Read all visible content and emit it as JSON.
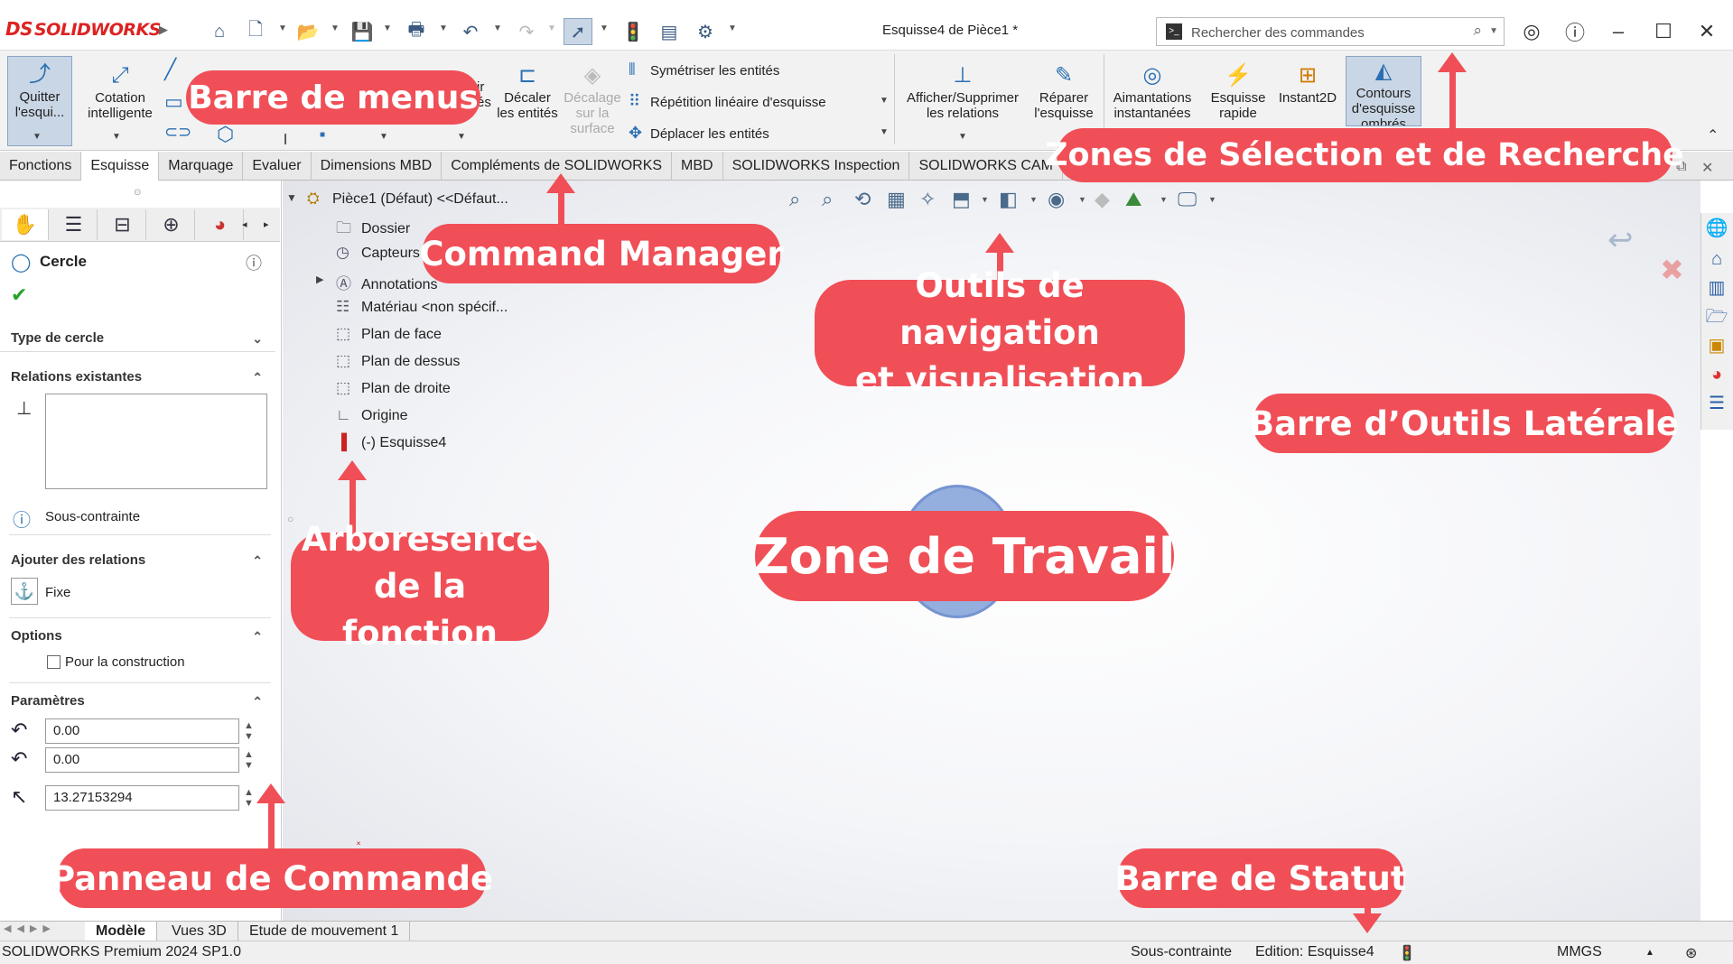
{
  "app": {
    "logo_text": "SOLIDWORKS",
    "logo_mark": "DS",
    "document_title": "Esquisse4 de Pièce1 *"
  },
  "search": {
    "placeholder": "Rechercher des commandes"
  },
  "ribbon": {
    "quit_sketch": "Quitter l'esqui...",
    "smart_dimension": "Cotation intelligente",
    "offset_entities_partial": "ir\nés",
    "offset_entities": "Décaler les entités",
    "offset_on_surface": "Décalage sur la surface",
    "mirror_entities": "Symétriser les entités",
    "linear_pattern": "Répétition linéaire d'esquisse",
    "move_entities": "Déplacer les entités",
    "display_relations": "Afficher/Supprimer les relations",
    "repair_sketch": "Réparer l'esquisse",
    "quick_snaps": "Aimantations instantanées",
    "rapid_sketch": "Esquisse rapide",
    "instant2d": "Instant2D",
    "shaded_contours": "Contours d'esquisse ombrés"
  },
  "tabs": [
    "Fonctions",
    "Esquisse",
    "Marquage",
    "Evaluer",
    "Dimensions MBD",
    "Compléments de SOLIDWORKS",
    "MBD",
    "SOLIDWORKS Inspection",
    "SOLIDWORKS CAM"
  ],
  "active_tab": "Esquisse",
  "property_manager": {
    "title": "Cercle",
    "sections": {
      "circle_type": "Type de cercle",
      "existing_relations": "Relations existantes",
      "add_relations": "Ajouter des relations",
      "options": "Options",
      "parameters": "Paramètres"
    },
    "status": "Sous-contrainte",
    "fix_label": "Fixe",
    "construction_label": "Pour la construction",
    "param_x": "0.00",
    "param_y": "0.00",
    "param_radius": "13.27153294"
  },
  "tree": {
    "root": "Pièce1 (Défaut) <<Défaut...",
    "items": [
      "Dossier",
      "Capteurs",
      "Annotations",
      "Matériau <non spécif...",
      "Plan de face",
      "Plan de dessus",
      "Plan de droite",
      "Origine",
      "(-) Esquisse4"
    ]
  },
  "bottom_tabs": [
    "Modèle",
    "Vues 3D",
    "Etude de mouvement 1"
  ],
  "status_bar": {
    "version": "SOLIDWORKS Premium 2024 SP1.0",
    "constraint": "Sous-contrainte",
    "editing": "Edition: Esquisse4",
    "units": "MMGS"
  },
  "annotations": {
    "menu_bar": "Barre de menus",
    "selection_search": "Zones de Sélection et de Recherche",
    "command_manager": "Command Manager",
    "nav_tools": "Outils de navigation\net visualisation",
    "side_toolbar": "Barre d’Outils Latérale",
    "workspace": "Zone de Travail",
    "feature_tree": "Arboresence\nde la fonction",
    "command_panel": "Panneau de Commande",
    "status_bar": "Barre de Statut"
  },
  "colors": {
    "callout": "#f04f57",
    "accent": "#2a6fb3",
    "logo": "#dd2222"
  }
}
